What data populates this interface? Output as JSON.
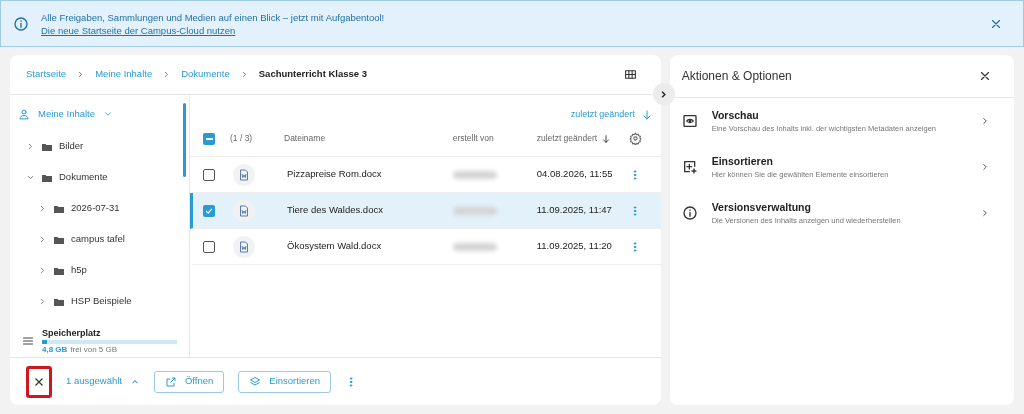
{
  "banner": {
    "message": "Alle Freigaben, Sammlungen und Medien auf einen Blick – jetzt mit Aufgabentool!",
    "link": "Die neue Startseite der Campus-Cloud nutzen"
  },
  "breadcrumb": [
    {
      "label": "Startseite",
      "current": false
    },
    {
      "label": "Meine Inhalte",
      "current": false
    },
    {
      "label": "Dokumente",
      "current": false
    },
    {
      "label": "Sachunterricht Klasse 3",
      "current": true
    }
  ],
  "sidebar": {
    "root": "Meine Inhalte",
    "tree": [
      {
        "label": "Bilder",
        "expanded": false
      },
      {
        "label": "Dokumente",
        "expanded": true,
        "children": [
          {
            "label": "2026-07-31",
            "expanded": false
          },
          {
            "label": "campus tafel",
            "expanded": false
          },
          {
            "label": "h5p",
            "expanded": false
          },
          {
            "label": "HSP Beispiele",
            "expanded": false
          }
        ]
      }
    ],
    "storage": {
      "label": "Speicherplatz",
      "used": "4,8 GB",
      "rest": "frei von 5 GB",
      "level": 0.04
    }
  },
  "table": {
    "sort_link": "zuletzt geändert",
    "select_all": {
      "indeterminate": true
    },
    "count": "(1 / 3)",
    "columns": [
      "Dateiname",
      "erstellt von",
      "zuletzt geändert"
    ],
    "rows": [
      {
        "name": "Pizzapreise Rom.docx",
        "modified": "04.08.2026, 11:55",
        "selected": false
      },
      {
        "name": "Tiere des Waldes.docx",
        "modified": "11.09.2025, 11:47",
        "selected": true
      },
      {
        "name": "Ökosystem Wald.docx",
        "modified": "11.09.2025, 11:20",
        "selected": false
      }
    ]
  },
  "bottom_bar": {
    "close_highlighted": true,
    "selection": "1 ausgewählt",
    "buttons": [
      {
        "label": "Öffnen",
        "kind": "open"
      },
      {
        "label": "Einsortieren",
        "kind": "sort"
      }
    ]
  },
  "panel": {
    "title": "Aktionen & Optionen",
    "items": [
      {
        "title": "Vorschau",
        "description": "Eine Vorschau des Inhalts inkl. der wichtigsten Metadaten anzeigen",
        "kind": "preview"
      },
      {
        "title": "Einsortieren",
        "description": "Hier können Sie die gewählten Elemente einsortieren",
        "kind": "insert"
      },
      {
        "title": "Versionsverwaltung",
        "description": "Die Versionen des Inhalts anzeigen und wiederherstellen",
        "kind": "info"
      }
    ]
  }
}
